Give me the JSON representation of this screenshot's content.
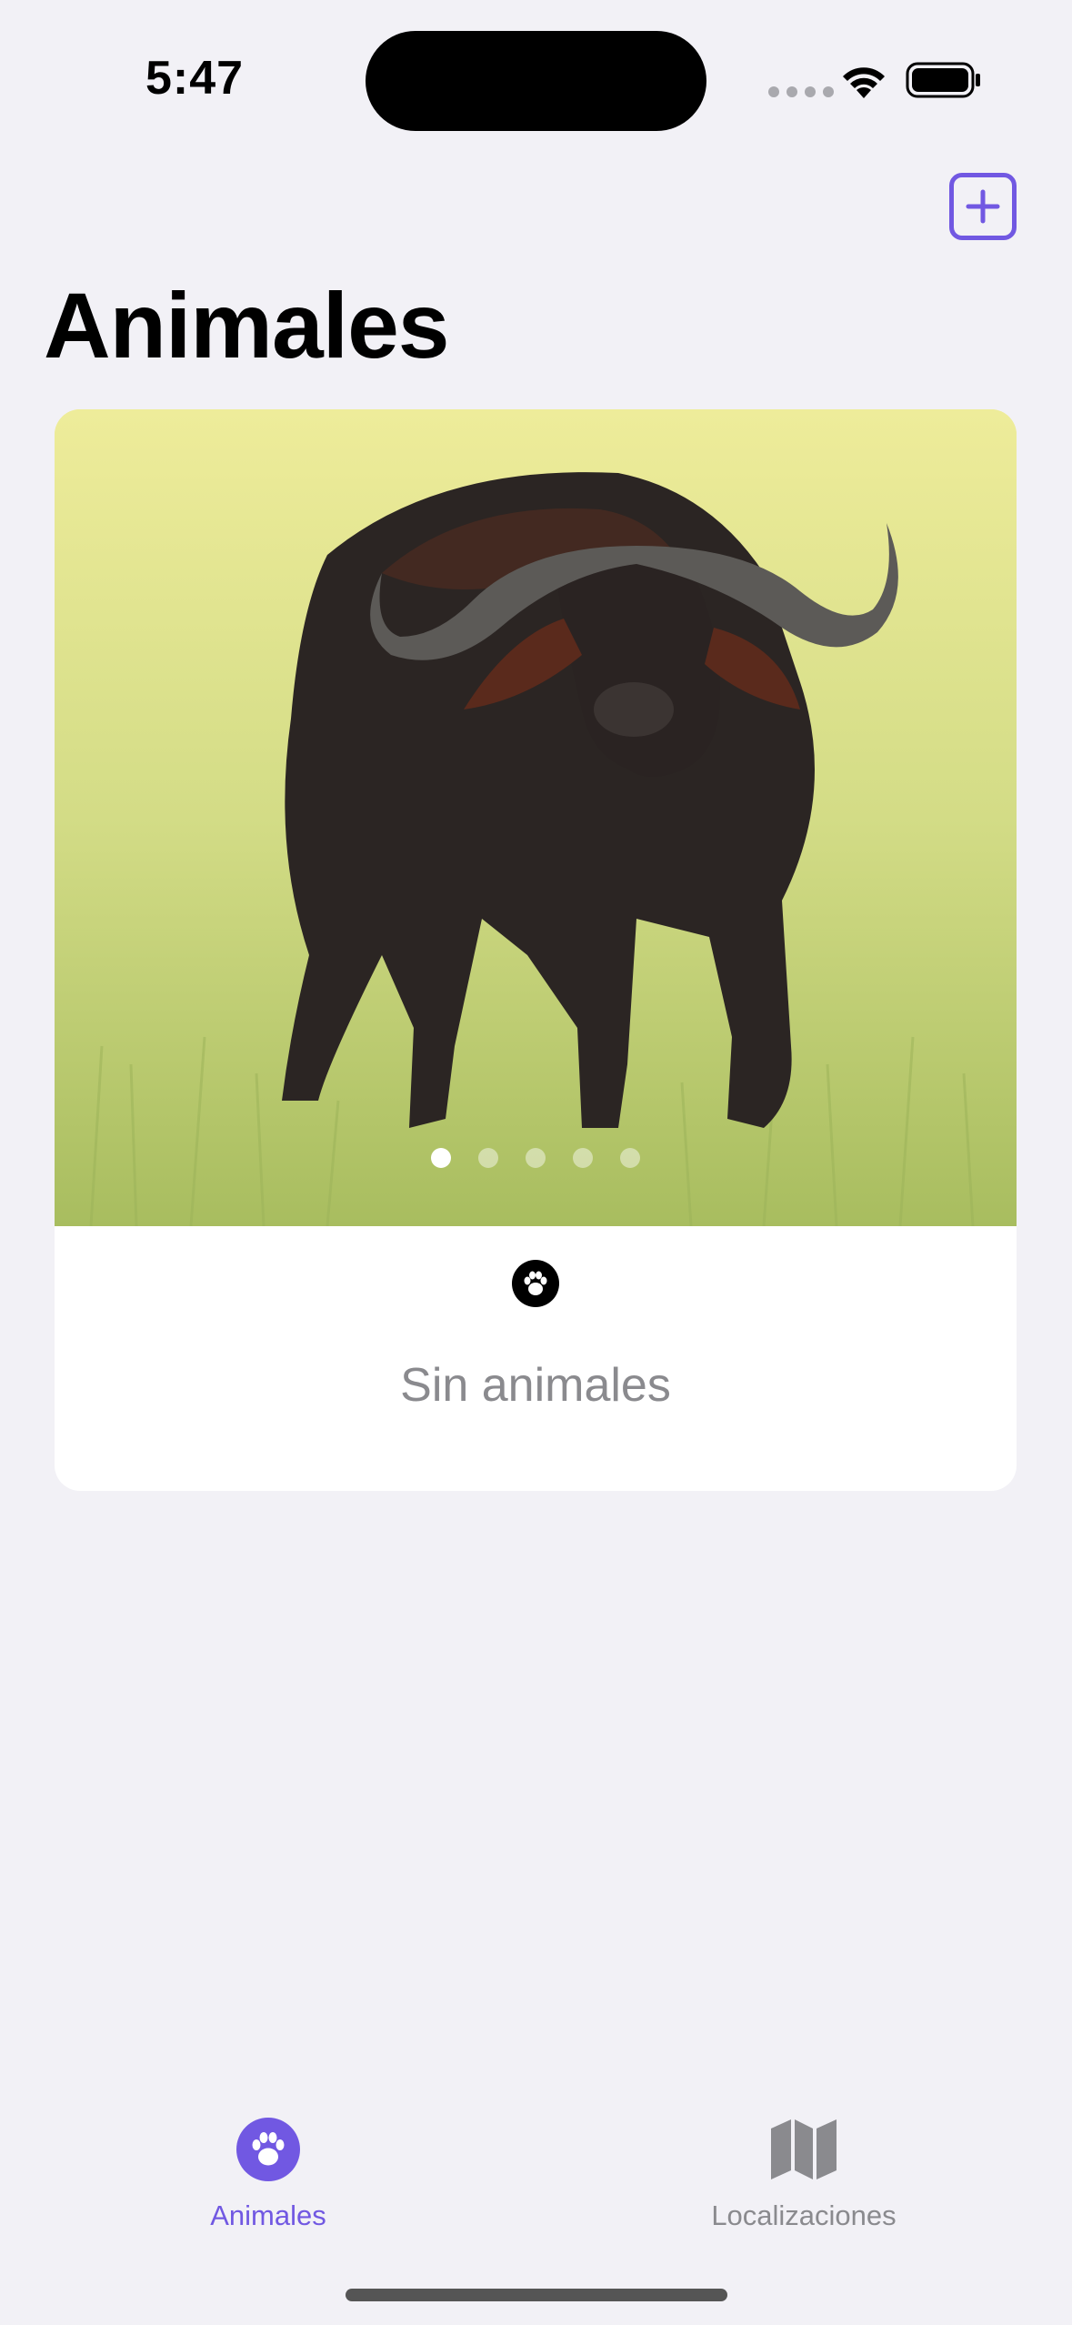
{
  "status_bar": {
    "time": "5:47"
  },
  "nav": {
    "title": "Animales",
    "add_icon": "plus-square-icon"
  },
  "card": {
    "photo_pages": 5,
    "active_page": 1,
    "badge_icon": "pawprint-icon",
    "empty_text": "Sin animales"
  },
  "tab_bar": {
    "tabs": [
      {
        "label": "Animales",
        "icon": "pawprint-circle-icon",
        "selected": true
      },
      {
        "label": "Localizaciones",
        "icon": "map-icon",
        "selected": false
      }
    ]
  },
  "colors": {
    "accent": "#7158E2",
    "background": "#F2F1F6",
    "secondary_text": "#8A8A8E"
  }
}
